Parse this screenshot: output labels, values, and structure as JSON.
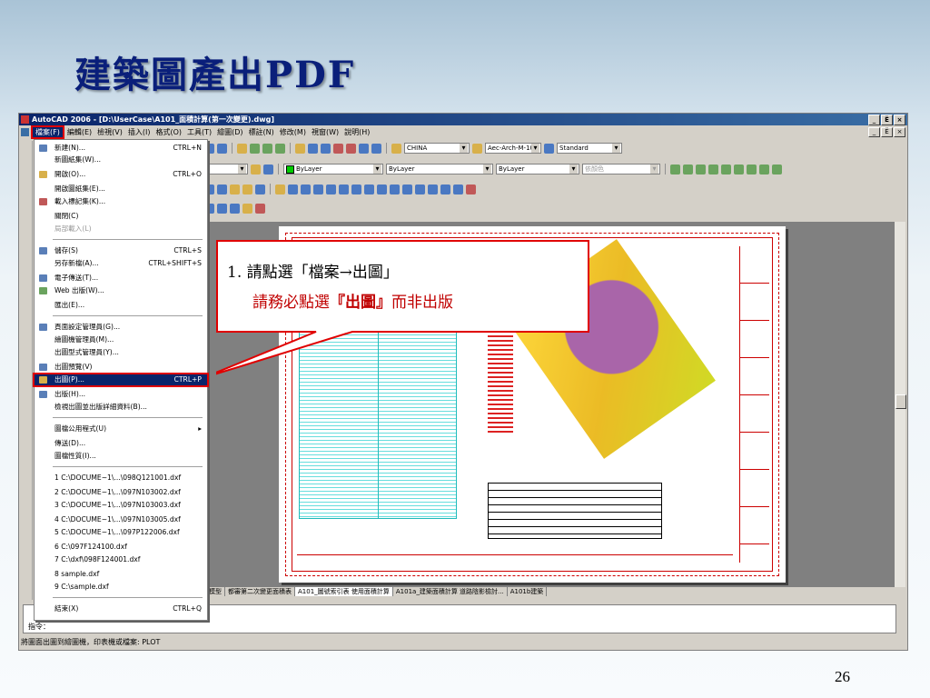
{
  "slide": {
    "title": "建築圖產出PDF",
    "page_number": "26"
  },
  "window": {
    "title": "AutoCAD 2006 - [D:\\UserCase\\A101_面積計算(第一次變更).dwg]",
    "controls": [
      "_",
      "Ё",
      "×"
    ],
    "doc_controls": [
      "_",
      "Ё",
      "×"
    ]
  },
  "menubar": [
    "檔案(F)",
    "編輯(E)",
    "檢視(V)",
    "插入(I)",
    "格式(O)",
    "工具(T)",
    "繪圖(D)",
    "標註(N)",
    "修改(M)",
    "視窗(W)",
    "說明(H)"
  ],
  "toolbar": {
    "text_style": "CHINA",
    "dim_style": "Aec-Arch-M-10",
    "table_style": "Standard",
    "layer": "ByLayer",
    "linetype": "ByLayer",
    "lineweight": "ByLayer",
    "plot_style": "依顏色"
  },
  "file_menu": [
    {
      "label": "新建(N)...",
      "shortcut": "CTRL+N",
      "icon": "new-icon"
    },
    {
      "label": "新圖紙集(W)...",
      "shortcut": ""
    },
    {
      "label": "開啟(O)...",
      "shortcut": "CTRL+O",
      "icon": "open-icon"
    },
    {
      "label": "開啟圖紙集(E)...",
      "shortcut": ""
    },
    {
      "label": "載入標記集(K)...",
      "shortcut": "",
      "icon": "markup-icon"
    },
    {
      "label": "關閉(C)",
      "shortcut": ""
    },
    {
      "label": "局部載入(L)",
      "shortcut": "",
      "disabled": true
    },
    {
      "label": "儲存(S)",
      "shortcut": "CTRL+S",
      "icon": "save-icon"
    },
    {
      "label": "另存新檔(A)...",
      "shortcut": "CTRL+SHIFT+S"
    },
    {
      "label": "電子傳送(T)...",
      "shortcut": "",
      "icon": "etransmit-icon"
    },
    {
      "label": "Web 出版(W)...",
      "shortcut": "",
      "icon": "web-icon"
    },
    {
      "label": "匯出(E)...",
      "shortcut": ""
    },
    {
      "label": "頁面設定管理員(G)...",
      "shortcut": "",
      "icon": "page-setup-icon"
    },
    {
      "label": "繪圖機管理員(M)...",
      "shortcut": ""
    },
    {
      "label": "出圖型式管理員(Y)...",
      "shortcut": ""
    },
    {
      "label": "出圖預覽(V)",
      "shortcut": "",
      "icon": "preview-icon"
    },
    {
      "label": "出圖(P)...",
      "shortcut": "CTRL+P",
      "icon": "plot-icon",
      "highlighted": true
    },
    {
      "label": "出版(H)...",
      "shortcut": "",
      "icon": "publish-icon"
    },
    {
      "label": "檢視出圖並出版詳細資料(B)...",
      "shortcut": ""
    },
    {
      "label": "圖檔公用程式(U)",
      "shortcut": "▸"
    },
    {
      "label": "傳送(D)...",
      "shortcut": ""
    },
    {
      "label": "圖檔性質(I)...",
      "shortcut": ""
    },
    {
      "label": "1 C:\\DOCUME~1\\...\\098Q121001.dxf",
      "shortcut": ""
    },
    {
      "label": "2 C:\\DOCUME~1\\...\\097N103002.dxf",
      "shortcut": ""
    },
    {
      "label": "3 C:\\DOCUME~1\\...\\097N103003.dxf",
      "shortcut": ""
    },
    {
      "label": "4 C:\\DOCUME~1\\...\\097N103005.dxf",
      "shortcut": ""
    },
    {
      "label": "5 C:\\DOCUME~1\\...\\097P122006.dxf",
      "shortcut": ""
    },
    {
      "label": "6 C:\\097F124100.dxf",
      "shortcut": ""
    },
    {
      "label": "7 C:\\dxf\\098F124001.dxf",
      "shortcut": ""
    },
    {
      "label": "8 sample.dxf",
      "shortcut": ""
    },
    {
      "label": "9 C:\\sample.dxf",
      "shortcut": ""
    },
    {
      "label": "結束(X)",
      "shortcut": "CTRL+Q"
    }
  ],
  "layout_tabs": [
    "模型",
    "都審第二次變更面積表",
    "A101_圖號索引表 使用面積計算",
    "A101a_建築面積計算 道路陰影檢討...",
    "A101b建築"
  ],
  "command": {
    "prompt": "指令：",
    "status": "將圖面出圖到繪圖機，印表機或檔案: PLOT"
  },
  "callout": {
    "line1": "1. 請點選「檔案→出圖」",
    "line2_pre": "請務必點選",
    "line2_bold": "『出圖』",
    "line2_post": "而非出版"
  },
  "colors": {
    "highlight": "#0a246a",
    "annotation_red": "#e00000",
    "title_blue": "#0a1f7a"
  }
}
